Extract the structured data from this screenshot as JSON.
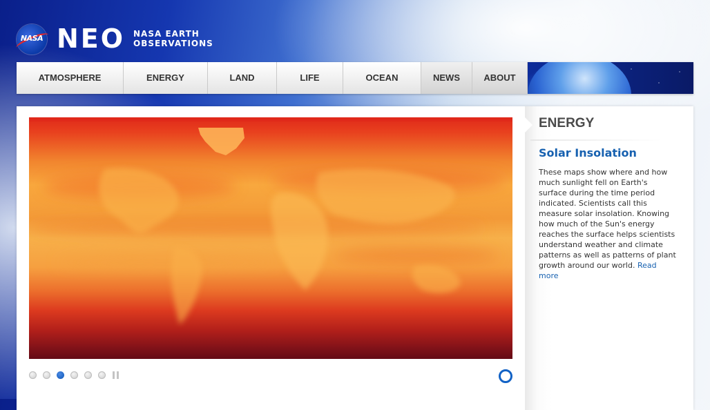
{
  "brand": {
    "logo_text": "NASA",
    "name": "NEO",
    "subtitle_line1": "NASA EARTH",
    "subtitle_line2": "OBSERVATIONS"
  },
  "nav": {
    "items": [
      {
        "label": "ATMOSPHERE"
      },
      {
        "label": "ENERGY"
      },
      {
        "label": "LAND"
      },
      {
        "label": "LIFE"
      },
      {
        "label": "OCEAN"
      },
      {
        "label": "NEWS"
      },
      {
        "label": "ABOUT"
      }
    ]
  },
  "feature": {
    "category": "ENERGY",
    "title": "Solar Insolation",
    "description": "These maps show where and how much sunlight fell on Earth's surface during the time period indicated. Scientists call this measure solar insolation. Knowing how much of the Sun's energy reaches the surface helps scientists understand weather and climate patterns as well as patterns of plant growth around our world.",
    "read_more": "Read more"
  },
  "carousel": {
    "slide_count": 6,
    "active_index": 2
  },
  "colors": {
    "accent_blue": "#1761b0",
    "nav_text": "#333333"
  }
}
